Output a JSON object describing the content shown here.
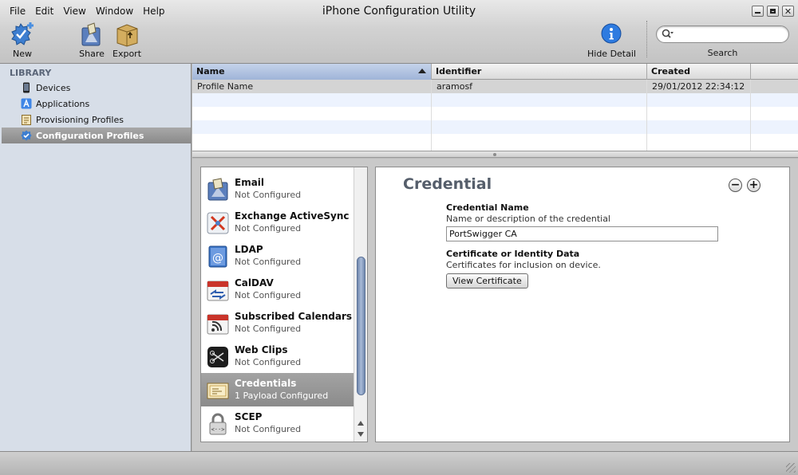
{
  "app": {
    "title": "iPhone Configuration Utility"
  },
  "menu": [
    "File",
    "Edit",
    "View",
    "Window",
    "Help"
  ],
  "toolbar": {
    "new_label": "New",
    "share_label": "Share",
    "export_label": "Export",
    "hide_detail_label": "Hide Detail",
    "search_label": "Search",
    "search_value": ""
  },
  "sidebar": {
    "heading": "LIBRARY",
    "items": [
      {
        "label": "Devices",
        "icon": "iphone-icon"
      },
      {
        "label": "Applications",
        "icon": "applications-icon"
      },
      {
        "label": "Provisioning Profiles",
        "icon": "provisioning-profile-icon"
      },
      {
        "label": "Configuration Profiles",
        "icon": "configuration-profile-icon",
        "selected": true
      }
    ]
  },
  "table": {
    "columns": [
      "Name",
      "Identifier",
      "Created"
    ],
    "sorted_column": "Name",
    "rows": [
      {
        "name": "Profile Name",
        "identifier": "aramosf",
        "created": "29/01/2012 22:34:12"
      }
    ]
  },
  "payloads": [
    {
      "title": "Email",
      "status": "Not Configured",
      "icon": "email-icon"
    },
    {
      "title": "Exchange ActiveSync",
      "status": "Not Configured",
      "icon": "exchange-icon"
    },
    {
      "title": "LDAP",
      "status": "Not Configured",
      "icon": "ldap-icon"
    },
    {
      "title": "CalDAV",
      "status": "Not Configured",
      "icon": "caldav-icon"
    },
    {
      "title": "Subscribed Calendars",
      "status": "Not Configured",
      "icon": "subscribed-calendar-icon"
    },
    {
      "title": "Web Clips",
      "status": "Not Configured",
      "icon": "web-clips-icon"
    },
    {
      "title": "Credentials",
      "status": "1 Payload Configured",
      "icon": "credential-icon",
      "selected": true
    },
    {
      "title": "SCEP",
      "status": "Not Configured",
      "icon": "scep-lock-icon"
    }
  ],
  "detail": {
    "title": "Credential",
    "credential_name_label": "Credential Name",
    "credential_name_help": "Name or description of the credential",
    "credential_name_value": "PortSwigger CA",
    "cert_label": "Certificate or Identity Data",
    "cert_help": "Certificates for inclusion on device.",
    "view_cert_button": "View Certificate",
    "remove_symbol": "−",
    "add_symbol": "+"
  },
  "colors": {
    "sidebar_bg": "#d7dee8",
    "selection_gray": "#8b8b8b",
    "sorted_header": "#9fb4d8",
    "alt_row": "#edf3fe"
  }
}
